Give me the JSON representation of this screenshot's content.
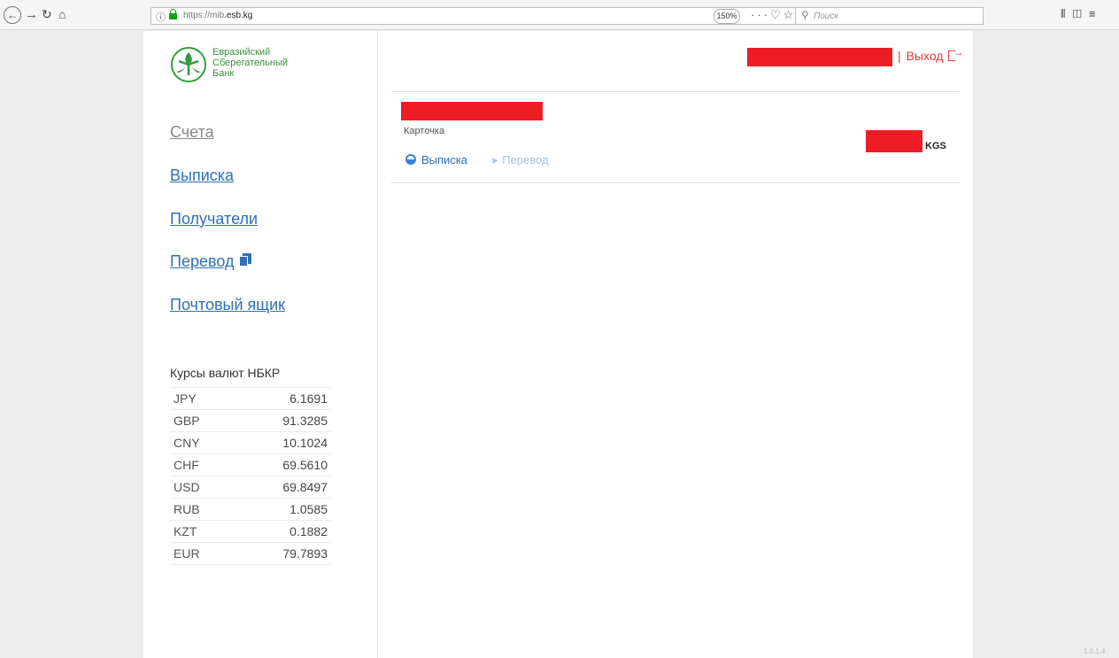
{
  "browser": {
    "url_scheme_host": "https://mib.",
    "url_domain": "esb.kg",
    "zoom": "150%",
    "search_placeholder": "Поиск"
  },
  "sidebar": {
    "logo_text_line1": "Евразийский",
    "logo_text_line2": "Сберегательный",
    "logo_text_line3": "Банк",
    "menu": [
      {
        "label": "Счета",
        "active": true
      },
      {
        "label": "Выписка"
      },
      {
        "label": "Получатели"
      },
      {
        "label": "Перевод"
      },
      {
        "label": "Почтовый ящик"
      }
    ],
    "rates_title": "Курсы валют НБКР",
    "rates": [
      {
        "code": "JPY",
        "value": "6.1691"
      },
      {
        "code": "GBP",
        "value": "91.3285"
      },
      {
        "code": "CNY",
        "value": "10.1024"
      },
      {
        "code": "CHF",
        "value": "69.5610"
      },
      {
        "code": "USD",
        "value": "69.8497"
      },
      {
        "code": "RUB",
        "value": "1.0585"
      },
      {
        "code": "KZT",
        "value": "0.1882"
      },
      {
        "code": "EUR",
        "value": "79.7893"
      }
    ]
  },
  "main": {
    "logout_sep": "|",
    "logout_label": "Выход",
    "card_label": "Карточка",
    "currency": "KGS",
    "tab_statement": "Выписка",
    "tab_transfer": "Перевод"
  },
  "footer": {
    "version": "1.0.1.4"
  },
  "colors": {
    "brand_green": "#2e9b3a",
    "link_blue": "#2e6fb8",
    "logout_red": "#e53a3a",
    "redaction_red": "#ee1c24"
  }
}
